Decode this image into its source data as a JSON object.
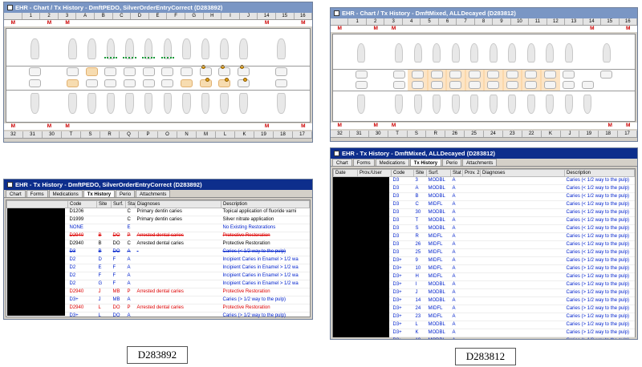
{
  "w1": {
    "title": "EHR - Chart / Tx History - DmftPEDO, SilverOrderEntryCorrect (D283892)",
    "top": [
      "",
      "1",
      "2",
      "3",
      "A",
      "B",
      "C",
      "D",
      "E",
      "F",
      "G",
      "H",
      "I",
      "J",
      "14",
      "15",
      "16"
    ],
    "topM": [
      "M",
      "",
      "M",
      "M",
      "",
      "",
      "",
      "",
      "",
      "",
      "",
      "",
      "",
      "",
      "M",
      "",
      "M"
    ],
    "botM": [
      "M",
      "",
      "M",
      "M",
      "",
      "",
      "",
      "",
      "",
      "",
      "",
      "",
      "",
      "",
      "M",
      "",
      "M"
    ],
    "bot": [
      "32",
      "31",
      "30",
      "T",
      "S",
      "R",
      "Q",
      "P",
      "O",
      "N",
      "M",
      "L",
      "K",
      "19",
      "18",
      "17"
    ]
  },
  "w2": {
    "title": "EHR - Chart / Tx History - DmftMixed, ALLDecayed (D283812)",
    "top": [
      "",
      "1",
      "2",
      "3",
      "4",
      "5",
      "6",
      "7",
      "8",
      "9",
      "10",
      "11",
      "12",
      "13",
      "14",
      "15",
      "16"
    ],
    "topM": [
      "M",
      "",
      "M",
      "M",
      "",
      "",
      "",
      "",
      "",
      "",
      "",
      "",
      "",
      "",
      "M",
      "",
      "M"
    ],
    "botM": [
      "M",
      "",
      "M",
      "M",
      "",
      "",
      "",
      "",
      "",
      "",
      "",
      "",
      "",
      "",
      "",
      "M",
      "M"
    ],
    "bot": [
      "32",
      "31",
      "30",
      "T",
      "S",
      "R",
      "26",
      "25",
      "24",
      "23",
      "22",
      "K",
      "J",
      "19",
      "18",
      "17"
    ]
  },
  "w3": {
    "title": "EHR - Tx History - DmftPEDO, SilverOrderEntryCorrect (D283892)",
    "tabs": [
      "Chart",
      "Forms",
      "Medications",
      "Tx History",
      "Perio",
      "Attachments"
    ],
    "cols": [
      "Code",
      "Site",
      "Surf.",
      "Stat",
      "Diagnoses",
      "Description"
    ],
    "rows": [
      {
        "c": "D1206",
        "s": "",
        "f": "",
        "t": "C",
        "d": "Primary dentin caries",
        "e": "Topical application of fluoride varni",
        "k": ""
      },
      {
        "c": "D1999",
        "s": "",
        "f": "",
        "t": "C",
        "d": "Primary dentin caries",
        "e": "Silver nitrate application",
        "k": ""
      },
      {
        "c": "NONE",
        "s": "",
        "f": "",
        "t": "E",
        "d": "",
        "e": "No Existing Restorations",
        "k": "blue"
      },
      {
        "c": "D2940",
        "s": "B",
        "f": "DO",
        "t": "P",
        "d": "Arrested dental caries",
        "e": "Protective Restoration",
        "k": "red strike"
      },
      {
        "c": "D2940",
        "s": "B",
        "f": "DO",
        "t": "C",
        "d": "Arrested dental caries",
        "e": "Protective Restoration",
        "k": ""
      },
      {
        "c": "D3",
        "s": "B",
        "f": "DO",
        "t": "A",
        "d": "-",
        "e": "Caries (< 1/2 way to the pulp)",
        "k": "blue strike"
      },
      {
        "c": "D2",
        "s": "D",
        "f": "F",
        "t": "A",
        "d": "",
        "e": "Incipient Caries in Enamel > 1/2 wa",
        "k": "blue"
      },
      {
        "c": "D2",
        "s": "E",
        "f": "F",
        "t": "A",
        "d": "",
        "e": "Incipient Caries in Enamel > 1/2 wa",
        "k": "blue"
      },
      {
        "c": "D2",
        "s": "F",
        "f": "F",
        "t": "A",
        "d": "",
        "e": "Incipient Caries in Enamel > 1/2 wa",
        "k": "blue"
      },
      {
        "c": "D2",
        "s": "G",
        "f": "F",
        "t": "A",
        "d": "",
        "e": "Incipient Caries in Enamel > 1/2 wa",
        "k": "blue"
      },
      {
        "c": "D2940",
        "s": "J",
        "f": "MB",
        "t": "P",
        "d": "Arrested dental caries",
        "e": "Protective Restoration",
        "k": "red"
      },
      {
        "c": "D3+",
        "s": "J",
        "f": "MB",
        "t": "A",
        "d": "",
        "e": "Caries (> 1/2 way to the pulp)",
        "k": "blue"
      },
      {
        "c": "D2940",
        "s": "L",
        "f": "DO",
        "t": "P",
        "d": "Arrested dental caries",
        "e": "Protective Restoration",
        "k": "red"
      },
      {
        "c": "D3+",
        "s": "L",
        "f": "DO",
        "t": "A",
        "d": "",
        "e": "Caries (> 1/2 way to the pulp)",
        "k": "blue"
      },
      {
        "c": "D2940",
        "s": "M",
        "f": "D",
        "t": "P",
        "d": "Arrested dental caries",
        "e": "Protective Restoration",
        "k": "red"
      },
      {
        "c": "D3+",
        "s": "M",
        "f": "D",
        "t": "A",
        "d": "",
        "e": "Caries (> 1/2 way to the pulp)",
        "k": "blue"
      },
      {
        "c": "D2940",
        "s": "T",
        "f": "MO",
        "t": "P",
        "d": "Arrested dental caries",
        "e": "Protective Restoration",
        "k": "red strike"
      },
      {
        "c": "D2940",
        "s": "T",
        "f": "MO",
        "t": "C",
        "d": "Arrested dental caries",
        "e": "Protective Restoration",
        "k": ""
      },
      {
        "c": "D3",
        "s": "T",
        "f": "MO",
        "t": "A",
        "d": "-",
        "e": "Caries (< 1/2 way to the pulp)",
        "k": "blue strike"
      }
    ]
  },
  "w4": {
    "title": "EHR - Tx History - DmftMixed, ALLDecayed (D283812)",
    "tabs": [
      "Chart",
      "Forms",
      "Medications",
      "Tx History",
      "Perio",
      "Attachments"
    ],
    "cols": [
      "Date",
      "Prov./User",
      "Code",
      "Site",
      "Surf.",
      "Stat",
      "Prov. 2",
      "Diagnoses",
      "Description"
    ],
    "rows": [
      [
        "D3",
        "3",
        "MODBL",
        "A",
        "Caries (< 1/2 way to the pulp)"
      ],
      [
        "D3",
        "A",
        "MODBL",
        "A",
        "Caries (< 1/2 way to the pulp)"
      ],
      [
        "D3",
        "B",
        "MODBL",
        "A",
        "Caries (< 1/2 way to the pulp)"
      ],
      [
        "D3",
        "C",
        "MIDFL",
        "A",
        "Caries (< 1/2 way to the pulp)"
      ],
      [
        "D3",
        "30",
        "MODBL",
        "A",
        "Caries (< 1/2 way to the pulp)"
      ],
      [
        "D3",
        "T",
        "MODBL",
        "A",
        "Caries (< 1/2 way to the pulp)"
      ],
      [
        "D3",
        "S",
        "MODBL",
        "A",
        "Caries (< 1/2 way to the pulp)"
      ],
      [
        "D3",
        "R",
        "MIDFL",
        "A",
        "Caries (< 1/2 way to the pulp)"
      ],
      [
        "D3",
        "26",
        "MIDFL",
        "A",
        "Caries (< 1/2 way to the pulp)"
      ],
      [
        "D3",
        "25",
        "MIDFL",
        "A",
        "Caries (< 1/2 way to the pulp)"
      ],
      [
        "D3+",
        "9",
        "MIDFL",
        "A",
        "Caries (> 1/2 way to the pulp)"
      ],
      [
        "D3+",
        "10",
        "MIDFL",
        "A",
        "Caries (> 1/2 way to the pulp)"
      ],
      [
        "D3+",
        "H",
        "MIDFL",
        "A",
        "Caries (> 1/2 way to the pulp)"
      ],
      [
        "D3+",
        "I",
        "MODBL",
        "A",
        "Caries (> 1/2 way to the pulp)"
      ],
      [
        "D3+",
        "J",
        "MODBL",
        "A",
        "Caries (> 1/2 way to the pulp)"
      ],
      [
        "D3+",
        "14",
        "MODBL",
        "A",
        "Caries (> 1/2 way to the pulp)"
      ],
      [
        "D3+",
        "24",
        "MIDFL",
        "A",
        "Caries (> 1/2 way to the pulp)"
      ],
      [
        "D3+",
        "23",
        "MIDFL",
        "A",
        "Caries (> 1/2 way to the pulp)"
      ],
      [
        "D3+",
        "L",
        "MODBL",
        "A",
        "Caries (> 1/2 way to the pulp)"
      ],
      [
        "D3+",
        "K",
        "MODBL",
        "A",
        "Caries (> 1/2 way to the pulp)"
      ],
      [
        "D3+",
        "19",
        "MODBL",
        "A",
        "Caries (> 1/2 way to the pulp)"
      ]
    ]
  },
  "captions": {
    "left": "D283892",
    "right": "D283812"
  }
}
